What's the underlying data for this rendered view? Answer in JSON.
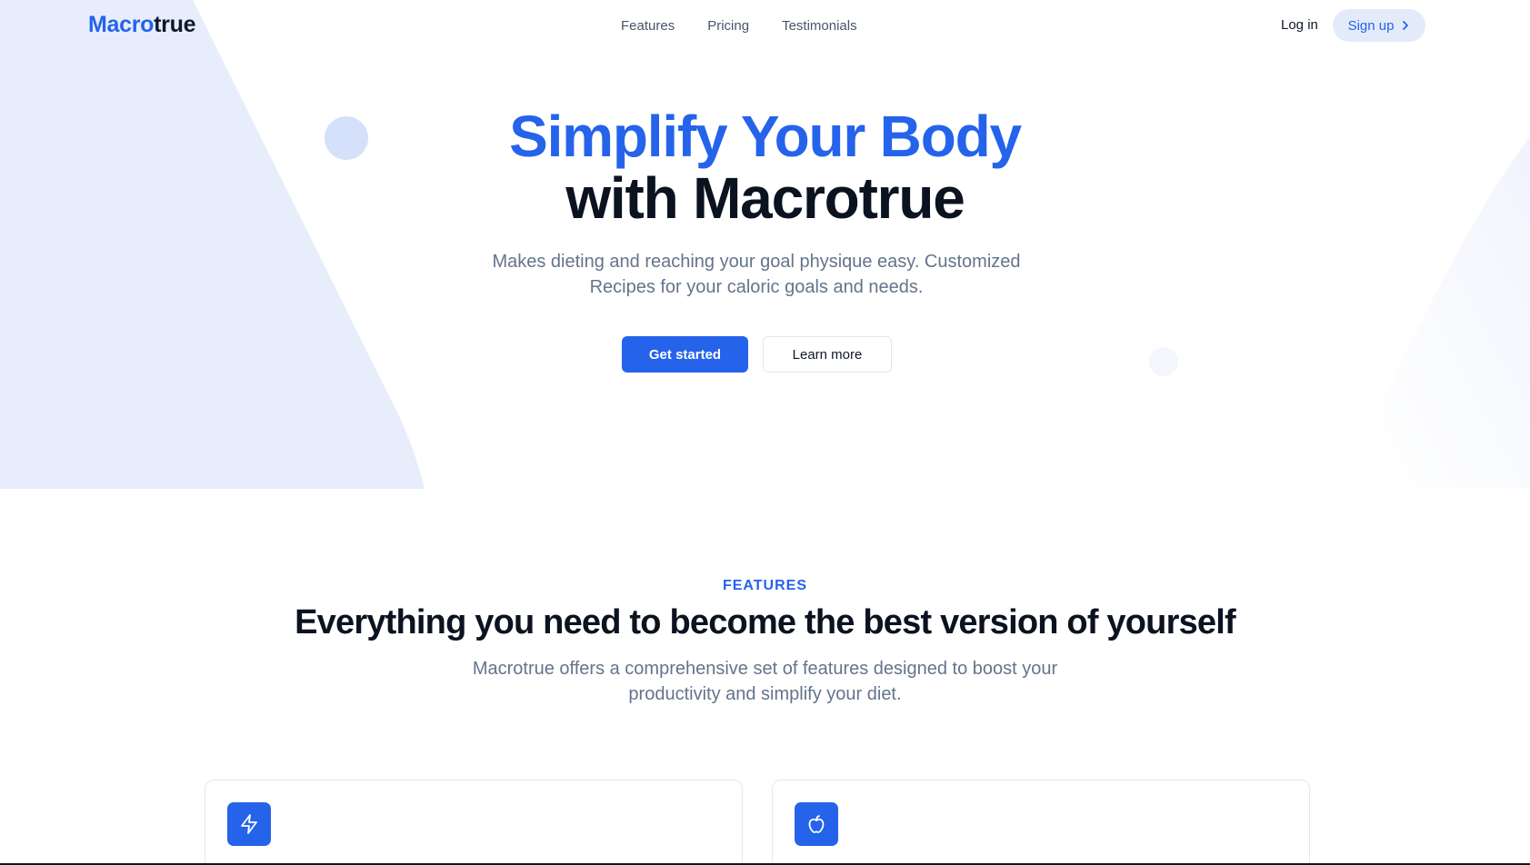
{
  "brand": {
    "part1": "Macro",
    "part2": "true"
  },
  "nav": {
    "links": [
      "Features",
      "Pricing",
      "Testimonials"
    ],
    "login": "Log in",
    "signup": "Sign up"
  },
  "hero": {
    "title_line1": "Simplify Your Body",
    "title_line2": "with Macrotrue",
    "subtitle": "Makes dieting and reaching your goal physique easy. Customized Recipes for your caloric goals and needs.",
    "primary_cta": "Get started",
    "secondary_cta": "Learn more"
  },
  "features": {
    "eyebrow": "FEATURES",
    "title": "Everything you need to become the best version of yourself",
    "subtitle": "Macrotrue offers a comprehensive set of features designed to boost your productivity and simplify your diet.",
    "cards": [
      {
        "icon": "lightning-icon"
      },
      {
        "icon": "apple-icon"
      }
    ]
  },
  "colors": {
    "accent": "#2563eb",
    "hero_shape": "#e8edfc",
    "text_muted": "#64748b",
    "signup_bg": "#e3ebfb"
  }
}
